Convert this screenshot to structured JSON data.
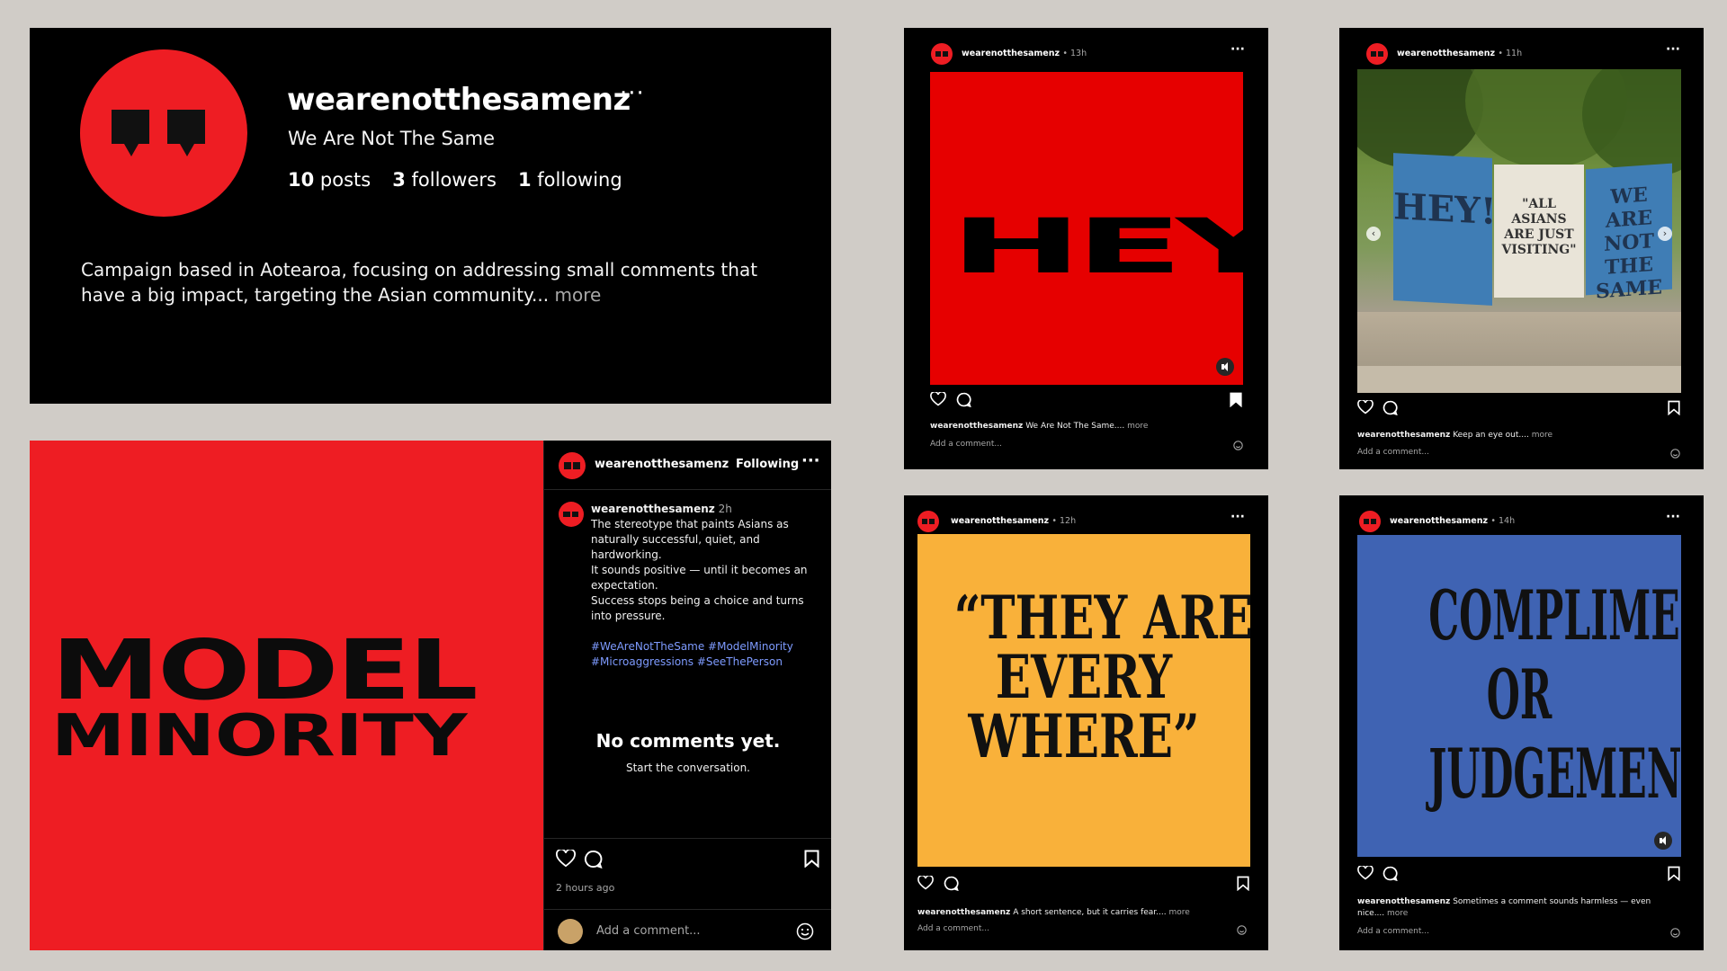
{
  "profile": {
    "username": "wearenotthesamenz",
    "more_dots": "···",
    "display_name": "We Are Not The Same",
    "posts_count": "10",
    "posts_label": "posts",
    "followers_count": "3",
    "followers_label": "followers",
    "following_count": "1",
    "following_label": "following",
    "bio": "Campaign based in Aotearoa, focusing on addressing small comments that have a big impact, targeting the Asian community...",
    "bio_more": "more"
  },
  "model_post": {
    "art_line1": "MODEL",
    "art_line2": "MINORITY",
    "username": "wearenotthesamenz",
    "follow_state": "Following",
    "more_dots": "···",
    "caption_time": "2h",
    "caption_lines": [
      "The stereotype that paints Asians as naturally successful, quiet, and hardworking.",
      "It sounds positive — until it becomes an expectation.",
      "Success stops being a choice and turns into pressure."
    ],
    "hashtags": "#WeAreNotTheSame #ModelMinority #Microaggressions #SeeThePerson",
    "no_comments_title": "No comments yet.",
    "no_comments_sub": "Start the conversation.",
    "posted_ago": "2 hours ago",
    "add_comment_placeholder": "Add a comment..."
  },
  "posts": [
    {
      "username": "wearenotthesamenz",
      "time": "• 13h",
      "more_dots": "···",
      "art_text": "HEY!",
      "art_bg": "#e60000",
      "caption_user": "wearenotthesamenz",
      "caption": "We Are Not The Same....",
      "more": "more",
      "add_comment": "Add a comment..."
    },
    {
      "username": "wearenotthesamenz",
      "time": "• 11h",
      "more_dots": "···",
      "billboard_1": "HEY!",
      "billboard_2": "\"ALL ASIANS ARE JUST VISITING\"",
      "billboard_3": "WE ARE NOT THE SAME",
      "caption_user": "wearenotthesamenz",
      "caption": "Keep an eye out....",
      "more": "more",
      "add_comment": "Add a comment..."
    },
    {
      "username": "wearenotthesamenz",
      "time": "• 12h",
      "more_dots": "···",
      "art_lines": [
        "“THEY ARE",
        "EVERY",
        "WHERE”"
      ],
      "art_bg": "#f9b13a",
      "caption_user": "wearenotthesamenz",
      "caption": "A short sentence, but it carries fear....",
      "more": "more",
      "add_comment": "Add a comment..."
    },
    {
      "username": "wearenotthesamenz",
      "time": "• 14h",
      "more_dots": "···",
      "art_lines": [
        "COMPLIMENT",
        "OR",
        "JUDGEMENT"
      ],
      "art_bg": "#3f63b3",
      "caption_user": "wearenotthesamenz",
      "caption": "Sometimes a comment sounds harmless — even nice....",
      "more": "more",
      "add_comment": "Add a comment..."
    }
  ],
  "colors": {
    "background": "#d0ccc7",
    "brand_red": "#ee1d23",
    "hashtag_blue": "#7e9bff"
  },
  "icons": [
    "quote-logo-icon",
    "heart-icon",
    "comment-icon",
    "bookmark-icon",
    "more-icon",
    "mute-icon",
    "smiley-icon",
    "chevron-left-icon",
    "chevron-right-icon"
  ]
}
